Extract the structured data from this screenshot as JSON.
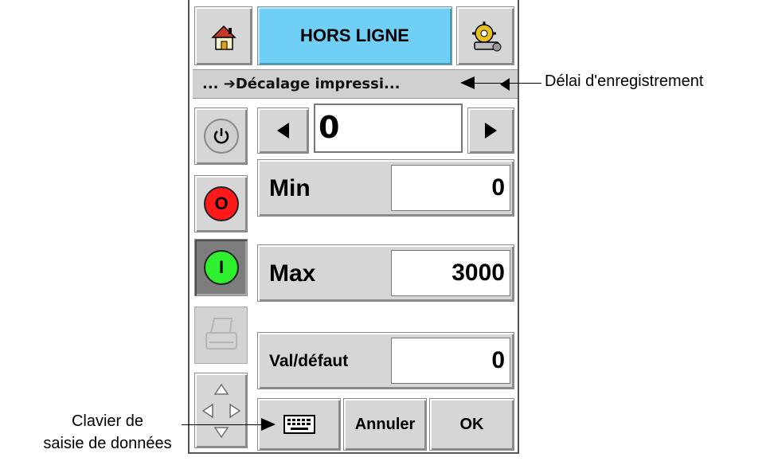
{
  "header": {
    "title": "HORS LIGNE",
    "home_icon": "home-icon",
    "settings_icon": "settings-icon"
  },
  "breadcrumb": {
    "text": "... ➔Décalage impressi..."
  },
  "side_buttons": {
    "power_icon": "power-icon",
    "stop_label": "O",
    "start_label": "I",
    "stop_color": "#ff1a1a",
    "start_color": "#2ef02e"
  },
  "value": {
    "current": "0"
  },
  "params": {
    "min_label": "Min",
    "min_value": "0",
    "max_label": "Max",
    "max_value": "3000",
    "default_label": "Val/défaut",
    "default_value": "0"
  },
  "bottom": {
    "cancel_label": "Annuler",
    "ok_label": "OK",
    "keyboard_icon": "keyboard-icon"
  },
  "callouts": {
    "registration_delay": "Délai d'enregistrement",
    "keyboard_line1": "Clavier de",
    "keyboard_line2": "saisie de données"
  },
  "colors": {
    "title_bar": "#6fcff5",
    "button_face": "#d6d6d6"
  }
}
